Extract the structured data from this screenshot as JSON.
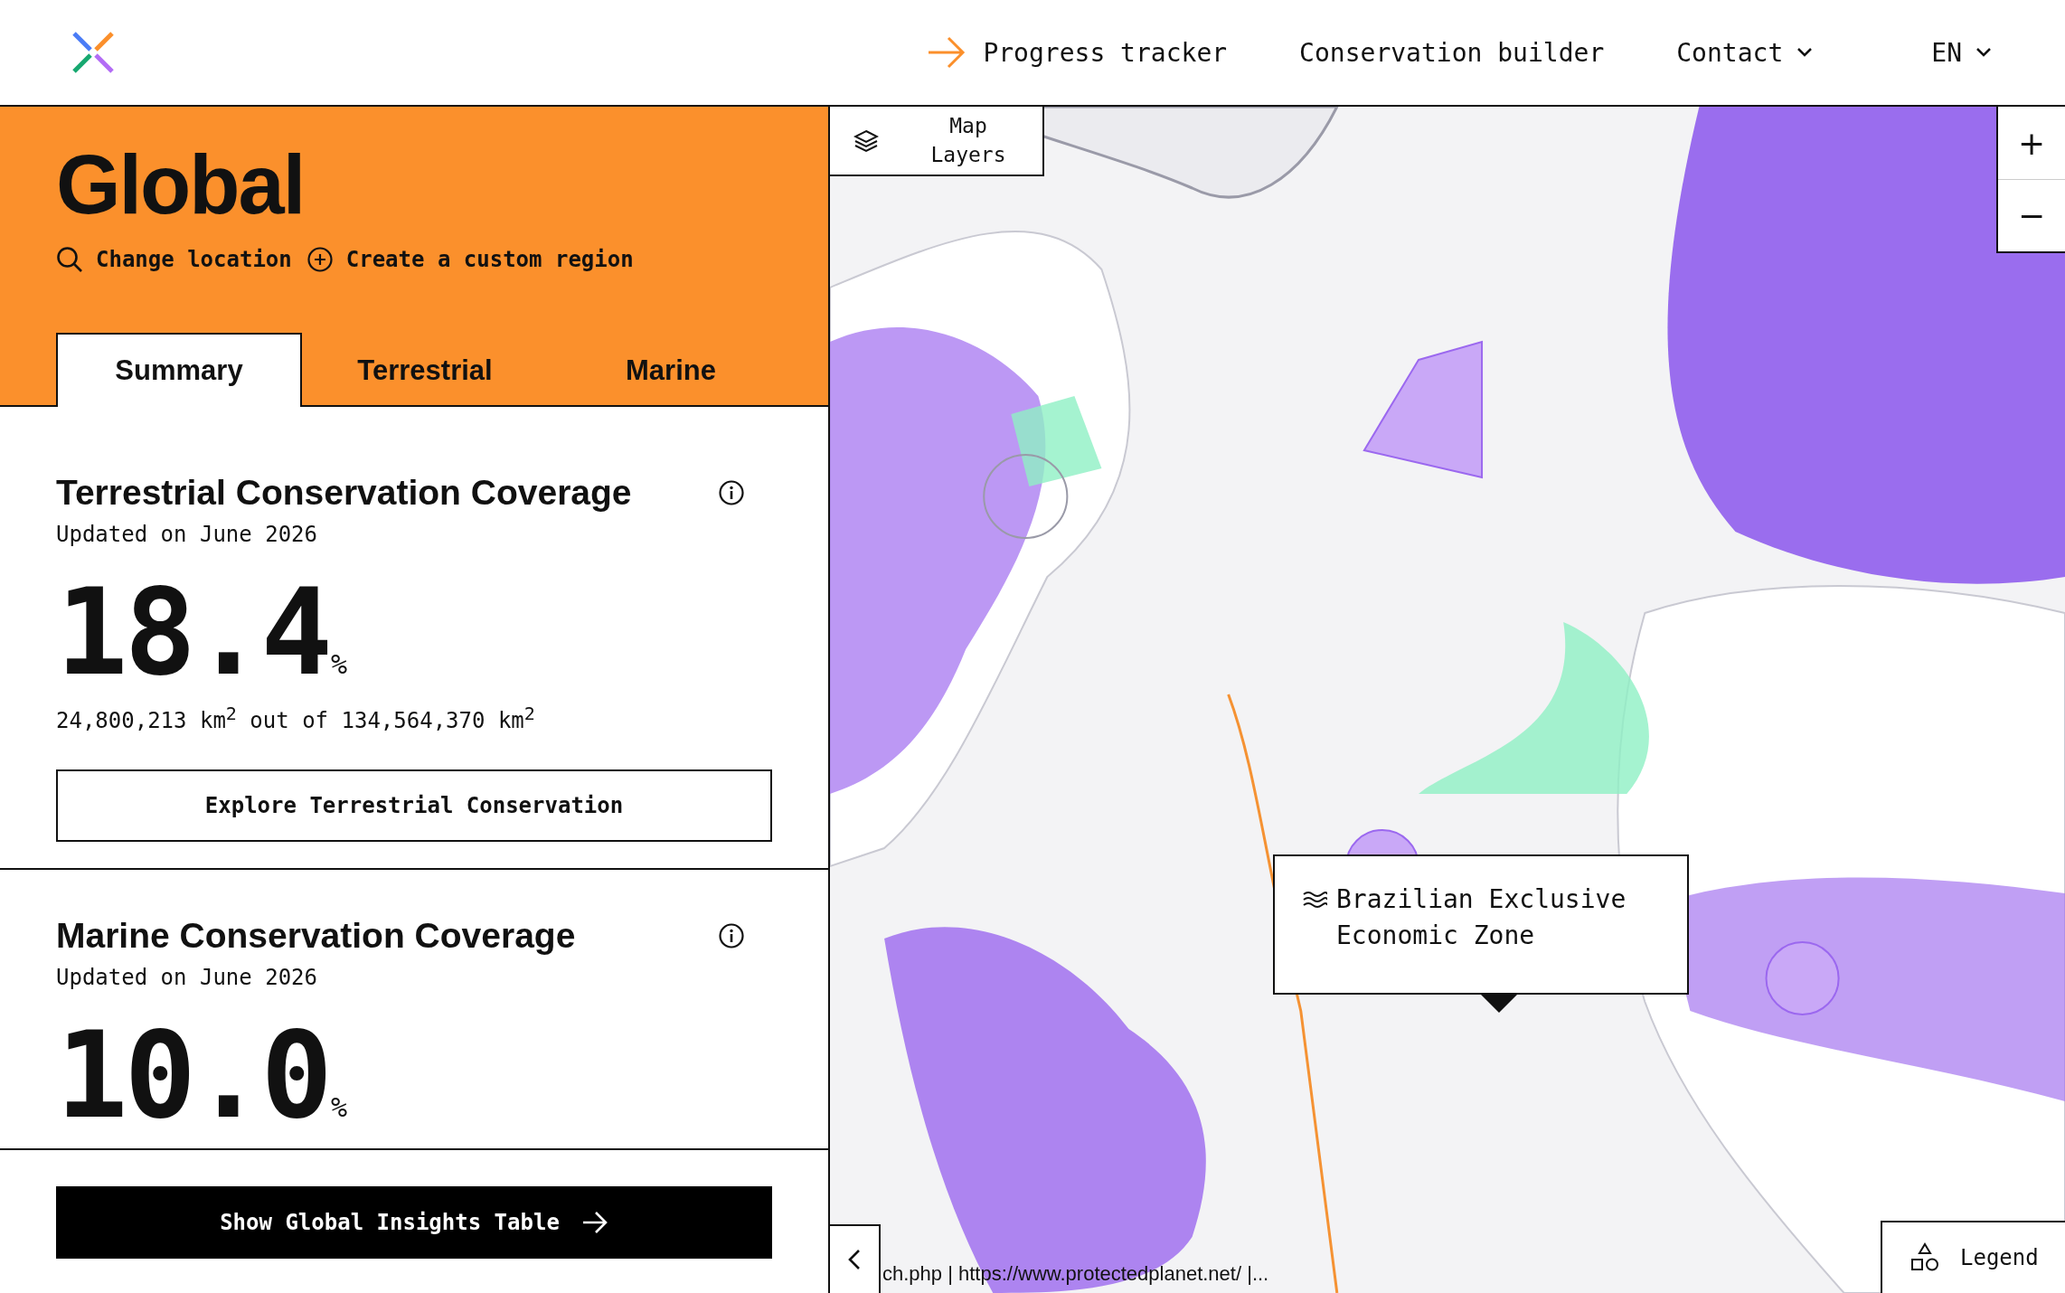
{
  "header": {
    "nav": [
      {
        "label": "Progress tracker",
        "kind": "arrow"
      },
      {
        "label": "Conservation builder",
        "kind": "plain"
      },
      {
        "label": "Contact",
        "kind": "dropdown"
      },
      {
        "label": "EN",
        "kind": "dropdown"
      }
    ]
  },
  "panel": {
    "title": "Global",
    "actions": [
      {
        "label": "Change location",
        "kind": "search"
      },
      {
        "label": "Create a custom region",
        "kind": "add"
      }
    ],
    "tabs": [
      {
        "label": "Summary",
        "selected": true
      },
      {
        "label": "Terrestrial",
        "selected": false
      },
      {
        "label": "Marine",
        "selected": false
      }
    ],
    "sections": [
      {
        "title": "Terrestrial Conservation Coverage",
        "updated": "Updated on June 2026",
        "value": "18.4",
        "unit": "%",
        "area": "24,800,213 km$^{2}$ out of 134,564,370 km$^{2}$",
        "button": "Explore Terrestrial Conservation"
      },
      {
        "title": "Marine Conservation Coverage",
        "updated": "Updated on June 2026",
        "value": "10.0",
        "unit": "%"
      }
    ],
    "insights_button": "Show Global Insights Table"
  },
  "map": {
    "layers_button": "Map Layers",
    "zoom_in": "+",
    "zoom_out": "−",
    "tooltip": "Brazilian Exclusive Economic Zone",
    "attribution": "ch.php | https://www.protectedplanet.net/ |...",
    "legend_button": "Legend"
  }
}
